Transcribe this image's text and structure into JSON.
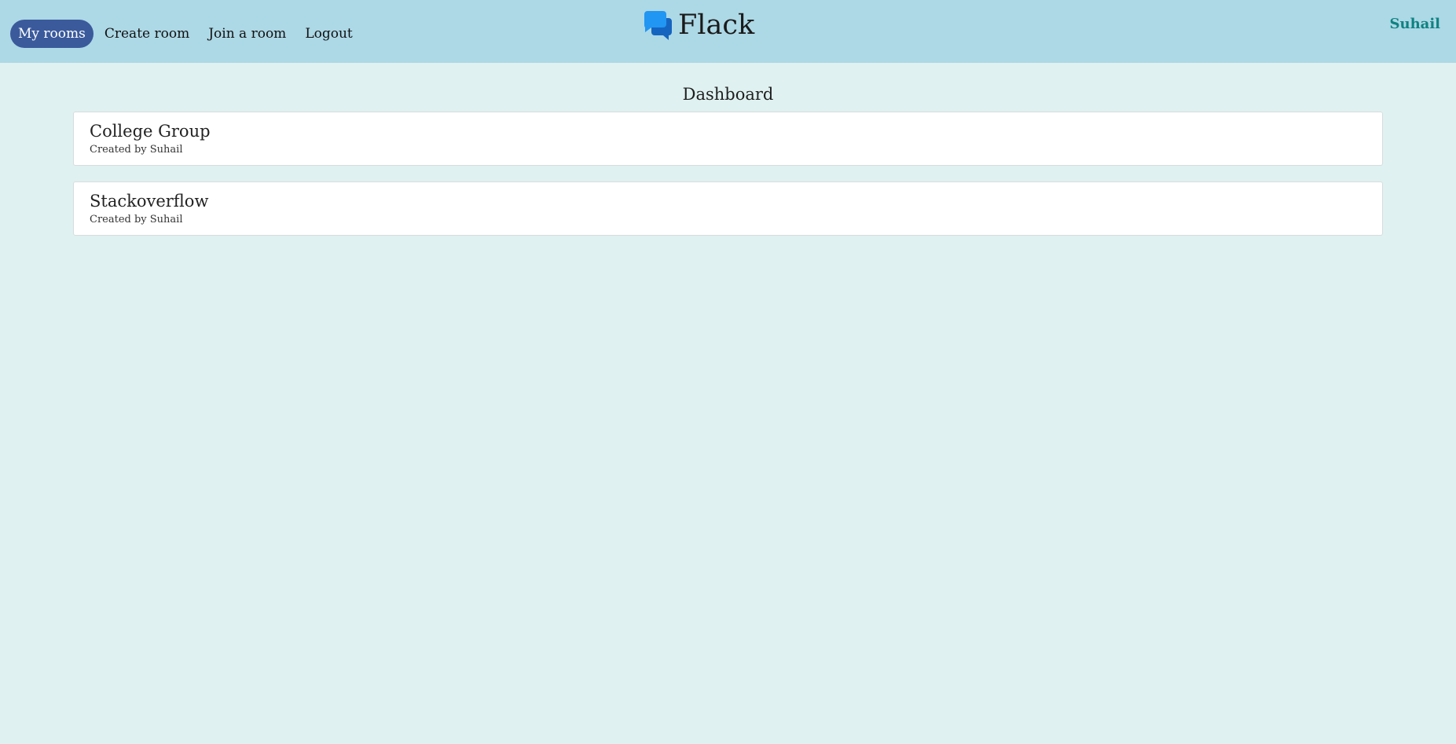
{
  "app": {
    "brand_name": "Flack",
    "brand_icon": "chat-bubbles-icon"
  },
  "nav": {
    "items": [
      {
        "label": "My rooms",
        "active": true
      },
      {
        "label": "Create room",
        "active": false
      },
      {
        "label": "Join a room",
        "active": false
      },
      {
        "label": "Logout",
        "active": false
      }
    ]
  },
  "user": {
    "name": "Suhail"
  },
  "main": {
    "title": "Dashboard",
    "rooms": [
      {
        "name": "College Group",
        "meta": "Created by Suhail"
      },
      {
        "name": "Stackoverflow",
        "meta": "Created by Suhail"
      }
    ]
  },
  "colors": {
    "navbar_bg": "#add8e6",
    "page_bg": "#dff1f0",
    "active_pill": "#3a5a9c",
    "user_name": "#0f8282",
    "icon_back": "#1565c0",
    "icon_front": "#2196f3"
  }
}
